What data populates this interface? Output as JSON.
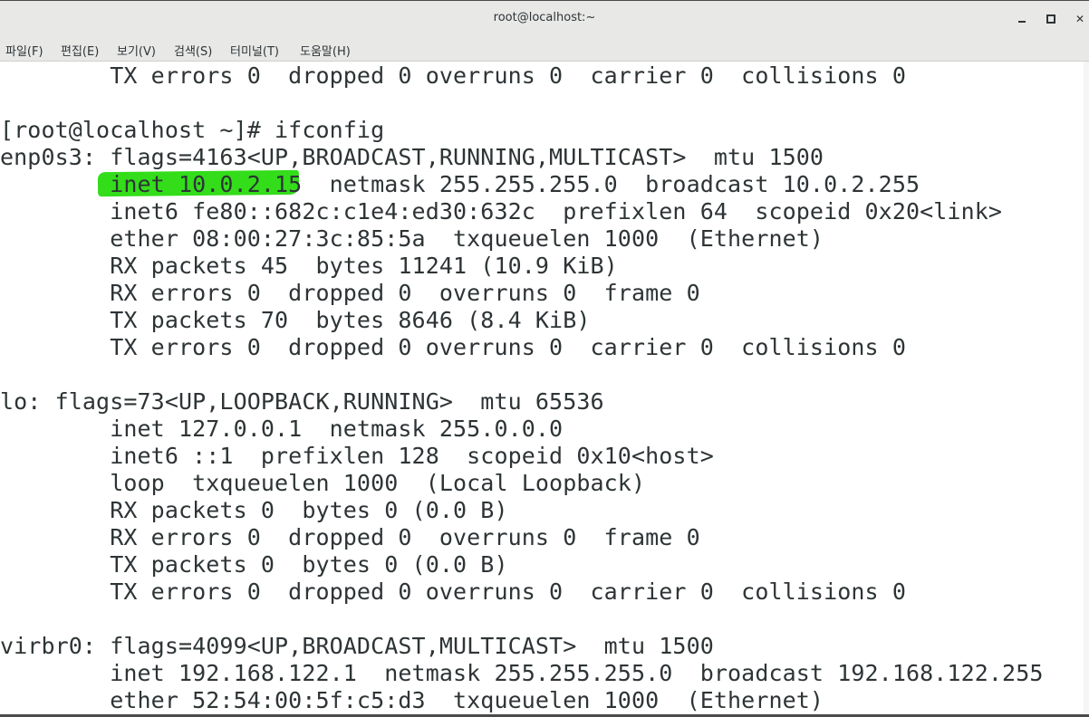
{
  "window": {
    "title": "root@localhost:~"
  },
  "menu": {
    "file": "파일(F)",
    "edit": "편집(E)",
    "view": "보기(V)",
    "search": "검색(S)",
    "terminal": "터미널(T)",
    "help": "도움말(H)"
  },
  "terminal": {
    "lines": [
      "        TX errors 0  dropped 0 overruns 0  carrier 0  collisions 0",
      "",
      "[root@localhost ~]# ifconfig",
      "enp0s3: flags=4163<UP,BROADCAST,RUNNING,MULTICAST>  mtu 1500",
      "        inet 10.0.2.15  netmask 255.255.255.0  broadcast 10.0.2.255",
      "        inet6 fe80::682c:c1e4:ed30:632c  prefixlen 64  scopeid 0x20<link>",
      "        ether 08:00:27:3c:85:5a  txqueuelen 1000  (Ethernet)",
      "        RX packets 45  bytes 11241 (10.9 KiB)",
      "        RX errors 0  dropped 0  overruns 0  frame 0",
      "        TX packets 70  bytes 8646 (8.4 KiB)",
      "        TX errors 0  dropped 0 overruns 0  carrier 0  collisions 0",
      "",
      "lo: flags=73<UP,LOOPBACK,RUNNING>  mtu 65536",
      "        inet 127.0.0.1  netmask 255.0.0.0",
      "        inet6 ::1  prefixlen 128  scopeid 0x10<host>",
      "        loop  txqueuelen 1000  (Local Loopback)",
      "        RX packets 0  bytes 0 (0.0 B)",
      "        RX errors 0  dropped 0  overruns 0  frame 0",
      "        TX packets 0  bytes 0 (0.0 B)",
      "        TX errors 0  dropped 0 overruns 0  carrier 0  collisions 0",
      "",
      "virbr0: flags=4099<UP,BROADCAST,MULTICAST>  mtu 1500",
      "        inet 192.168.122.1  netmask 255.255.255.0  broadcast 192.168.122.255",
      "        ether 52:54:00:5f:c5:d3  txqueuelen 1000  (Ethernet)"
    ],
    "highlight_color": "#33dd1a"
  }
}
